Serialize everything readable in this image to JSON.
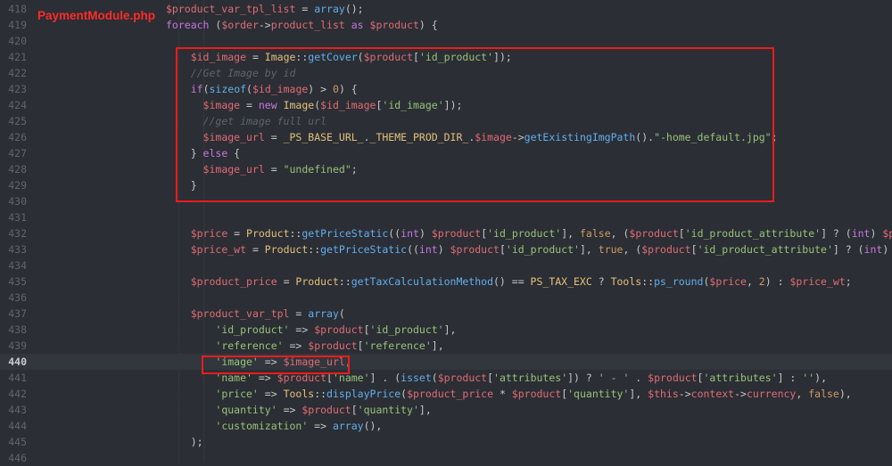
{
  "file_label": "PaymentModule.php",
  "colors": {
    "background": "#2b2e34",
    "highlight_box": "#ee1c1c",
    "file_label": "#ff2a2a"
  },
  "active_line": "440",
  "lines": [
    {
      "num": "418",
      "tokens": [
        [
          "v",
          "$product_var_tpl_list"
        ],
        [
          "o",
          " = "
        ],
        [
          "f",
          "array"
        ],
        [
          "o",
          "();"
        ]
      ]
    },
    {
      "num": "419",
      "tokens": [
        [
          "k",
          "foreach"
        ],
        [
          "o",
          " ("
        ],
        [
          "v",
          "$order"
        ],
        [
          "o",
          "->"
        ],
        [
          "v",
          "product_list"
        ],
        [
          "k",
          " as "
        ],
        [
          "v",
          "$product"
        ],
        [
          "o",
          ") {"
        ]
      ]
    },
    {
      "num": "420",
      "tokens": []
    },
    {
      "num": "421",
      "tokens": [
        [
          "o",
          "    "
        ],
        [
          "v",
          "$id_image"
        ],
        [
          "o",
          " = "
        ],
        [
          "cl",
          "Image"
        ],
        [
          "o",
          "::"
        ],
        [
          "f",
          "getCover"
        ],
        [
          "o",
          "("
        ],
        [
          "v",
          "$product"
        ],
        [
          "o",
          "["
        ],
        [
          "s",
          "'id_product'"
        ],
        [
          "o",
          "]);"
        ]
      ]
    },
    {
      "num": "422",
      "tokens": [
        [
          "o",
          "    "
        ],
        [
          "c",
          "//Get Image by id"
        ]
      ]
    },
    {
      "num": "423",
      "tokens": [
        [
          "o",
          "    "
        ],
        [
          "k",
          "if"
        ],
        [
          "o",
          "("
        ],
        [
          "f",
          "sizeof"
        ],
        [
          "o",
          "("
        ],
        [
          "v",
          "$id_image"
        ],
        [
          "o",
          ") > "
        ],
        [
          "n",
          "0"
        ],
        [
          "o",
          ") {"
        ]
      ]
    },
    {
      "num": "424",
      "tokens": [
        [
          "o",
          "      "
        ],
        [
          "v",
          "$image"
        ],
        [
          "o",
          " = "
        ],
        [
          "k",
          "new "
        ],
        [
          "cl",
          "Image"
        ],
        [
          "o",
          "("
        ],
        [
          "v",
          "$id_image"
        ],
        [
          "o",
          "["
        ],
        [
          "s",
          "'id_image'"
        ],
        [
          "o",
          "]);"
        ]
      ]
    },
    {
      "num": "425",
      "tokens": [
        [
          "o",
          "      "
        ],
        [
          "c",
          "//get image full url"
        ]
      ]
    },
    {
      "num": "426",
      "tokens": [
        [
          "o",
          "      "
        ],
        [
          "v",
          "$image_url"
        ],
        [
          "o",
          " = "
        ],
        [
          "cl",
          "_PS_BASE_URL_"
        ],
        [
          "o",
          "."
        ],
        [
          "cl",
          "_THEME_PROD_DIR_"
        ],
        [
          "o",
          "."
        ],
        [
          "v",
          "$image"
        ],
        [
          "o",
          "->"
        ],
        [
          "f",
          "getExistingImgPath"
        ],
        [
          "o",
          "()."
        ],
        [
          "s",
          "\"-home_default.jpg\""
        ],
        [
          "o",
          ";"
        ]
      ]
    },
    {
      "num": "427",
      "tokens": [
        [
          "o",
          "    } "
        ],
        [
          "k",
          "else"
        ],
        [
          "o",
          " {"
        ]
      ]
    },
    {
      "num": "428",
      "tokens": [
        [
          "o",
          "      "
        ],
        [
          "v",
          "$image_url"
        ],
        [
          "o",
          " = "
        ],
        [
          "s",
          "\"undefined\""
        ],
        [
          "o",
          ";"
        ]
      ]
    },
    {
      "num": "429",
      "tokens": [
        [
          "o",
          "    }"
        ]
      ]
    },
    {
      "num": "430",
      "tokens": []
    },
    {
      "num": "431",
      "tokens": []
    },
    {
      "num": "432",
      "tokens": [
        [
          "o",
          "    "
        ],
        [
          "v",
          "$price"
        ],
        [
          "o",
          " = "
        ],
        [
          "cl",
          "Product"
        ],
        [
          "o",
          "::"
        ],
        [
          "f",
          "getPriceStatic"
        ],
        [
          "o",
          "(("
        ],
        [
          "k",
          "int"
        ],
        [
          "o",
          ") "
        ],
        [
          "v",
          "$product"
        ],
        [
          "o",
          "["
        ],
        [
          "s",
          "'id_product'"
        ],
        [
          "o",
          "], "
        ],
        [
          "n",
          "false"
        ],
        [
          "o",
          ", ("
        ],
        [
          "v",
          "$product"
        ],
        [
          "o",
          "["
        ],
        [
          "s",
          "'id_product_attribute'"
        ],
        [
          "o",
          "] ? ("
        ],
        [
          "k",
          "int"
        ],
        [
          "o",
          ") "
        ],
        [
          "v",
          "$pro"
        ]
      ]
    },
    {
      "num": "433",
      "tokens": [
        [
          "o",
          "    "
        ],
        [
          "v",
          "$price_wt"
        ],
        [
          "o",
          " = "
        ],
        [
          "cl",
          "Product"
        ],
        [
          "o",
          "::"
        ],
        [
          "f",
          "getPriceStatic"
        ],
        [
          "o",
          "(("
        ],
        [
          "k",
          "int"
        ],
        [
          "o",
          ") "
        ],
        [
          "v",
          "$product"
        ],
        [
          "o",
          "["
        ],
        [
          "s",
          "'id_product'"
        ],
        [
          "o",
          "], "
        ],
        [
          "n",
          "true"
        ],
        [
          "o",
          ", ("
        ],
        [
          "v",
          "$product"
        ],
        [
          "o",
          "["
        ],
        [
          "s",
          "'id_product_attribute'"
        ],
        [
          "o",
          "] ? ("
        ],
        [
          "k",
          "int"
        ],
        [
          "o",
          ") "
        ],
        [
          "v",
          "$p"
        ]
      ]
    },
    {
      "num": "434",
      "tokens": []
    },
    {
      "num": "435",
      "tokens": [
        [
          "o",
          "    "
        ],
        [
          "v",
          "$product_price"
        ],
        [
          "o",
          " = "
        ],
        [
          "cl",
          "Product"
        ],
        [
          "o",
          "::"
        ],
        [
          "f",
          "getTaxCalculationMethod"
        ],
        [
          "o",
          "() == "
        ],
        [
          "cl",
          "PS_TAX_EXC"
        ],
        [
          "o",
          " ? "
        ],
        [
          "cl",
          "Tools"
        ],
        [
          "o",
          "::"
        ],
        [
          "f",
          "ps_round"
        ],
        [
          "o",
          "("
        ],
        [
          "v",
          "$price"
        ],
        [
          "o",
          ", "
        ],
        [
          "n",
          "2"
        ],
        [
          "o",
          ") : "
        ],
        [
          "v",
          "$price_wt"
        ],
        [
          "o",
          ";"
        ]
      ]
    },
    {
      "num": "436",
      "tokens": []
    },
    {
      "num": "437",
      "tokens": [
        [
          "o",
          "    "
        ],
        [
          "v",
          "$product_var_tpl"
        ],
        [
          "o",
          " = "
        ],
        [
          "f",
          "array"
        ],
        [
          "o",
          "("
        ]
      ]
    },
    {
      "num": "438",
      "tokens": [
        [
          "o",
          "        "
        ],
        [
          "s",
          "'id_product'"
        ],
        [
          "o",
          " => "
        ],
        [
          "v",
          "$product"
        ],
        [
          "o",
          "["
        ],
        [
          "s",
          "'id_product'"
        ],
        [
          "o",
          "],"
        ]
      ]
    },
    {
      "num": "439",
      "tokens": [
        [
          "o",
          "        "
        ],
        [
          "s",
          "'reference'"
        ],
        [
          "o",
          " => "
        ],
        [
          "v",
          "$product"
        ],
        [
          "o",
          "["
        ],
        [
          "s",
          "'reference'"
        ],
        [
          "o",
          "],"
        ]
      ]
    },
    {
      "num": "440",
      "tokens": [
        [
          "o",
          "        "
        ],
        [
          "s",
          "'image'"
        ],
        [
          "o",
          " => "
        ],
        [
          "v",
          "$image_url"
        ],
        [
          "o",
          ","
        ]
      ]
    },
    {
      "num": "441",
      "tokens": [
        [
          "o",
          "        "
        ],
        [
          "s",
          "'name'"
        ],
        [
          "o",
          " => "
        ],
        [
          "v",
          "$product"
        ],
        [
          "o",
          "["
        ],
        [
          "s",
          "'name'"
        ],
        [
          "o",
          "] . ("
        ],
        [
          "f",
          "isset"
        ],
        [
          "o",
          "("
        ],
        [
          "v",
          "$product"
        ],
        [
          "o",
          "["
        ],
        [
          "s",
          "'attributes'"
        ],
        [
          "o",
          "]) ? "
        ],
        [
          "s",
          "' - '"
        ],
        [
          "o",
          " . "
        ],
        [
          "v",
          "$product"
        ],
        [
          "o",
          "["
        ],
        [
          "s",
          "'attributes'"
        ],
        [
          "o",
          "] : "
        ],
        [
          "s",
          "''"
        ],
        [
          "o",
          "),"
        ]
      ]
    },
    {
      "num": "442",
      "tokens": [
        [
          "o",
          "        "
        ],
        [
          "s",
          "'price'"
        ],
        [
          "o",
          " => "
        ],
        [
          "cl",
          "Tools"
        ],
        [
          "o",
          "::"
        ],
        [
          "f",
          "displayPrice"
        ],
        [
          "o",
          "("
        ],
        [
          "v",
          "$product_price"
        ],
        [
          "o",
          " * "
        ],
        [
          "v",
          "$product"
        ],
        [
          "o",
          "["
        ],
        [
          "s",
          "'quantity'"
        ],
        [
          "o",
          "], "
        ],
        [
          "v",
          "$this"
        ],
        [
          "o",
          "->"
        ],
        [
          "v",
          "context"
        ],
        [
          "o",
          "->"
        ],
        [
          "v",
          "currency"
        ],
        [
          "o",
          ", "
        ],
        [
          "n",
          "false"
        ],
        [
          "o",
          "),"
        ]
      ]
    },
    {
      "num": "443",
      "tokens": [
        [
          "o",
          "        "
        ],
        [
          "s",
          "'quantity'"
        ],
        [
          "o",
          " => "
        ],
        [
          "v",
          "$product"
        ],
        [
          "o",
          "["
        ],
        [
          "s",
          "'quantity'"
        ],
        [
          "o",
          "],"
        ]
      ]
    },
    {
      "num": "444",
      "tokens": [
        [
          "o",
          "        "
        ],
        [
          "s",
          "'customization'"
        ],
        [
          "o",
          " => "
        ],
        [
          "f",
          "array"
        ],
        [
          "o",
          "(),"
        ]
      ]
    },
    {
      "num": "445",
      "tokens": [
        [
          "o",
          "    );"
        ]
      ]
    },
    {
      "num": "446",
      "tokens": []
    }
  ]
}
